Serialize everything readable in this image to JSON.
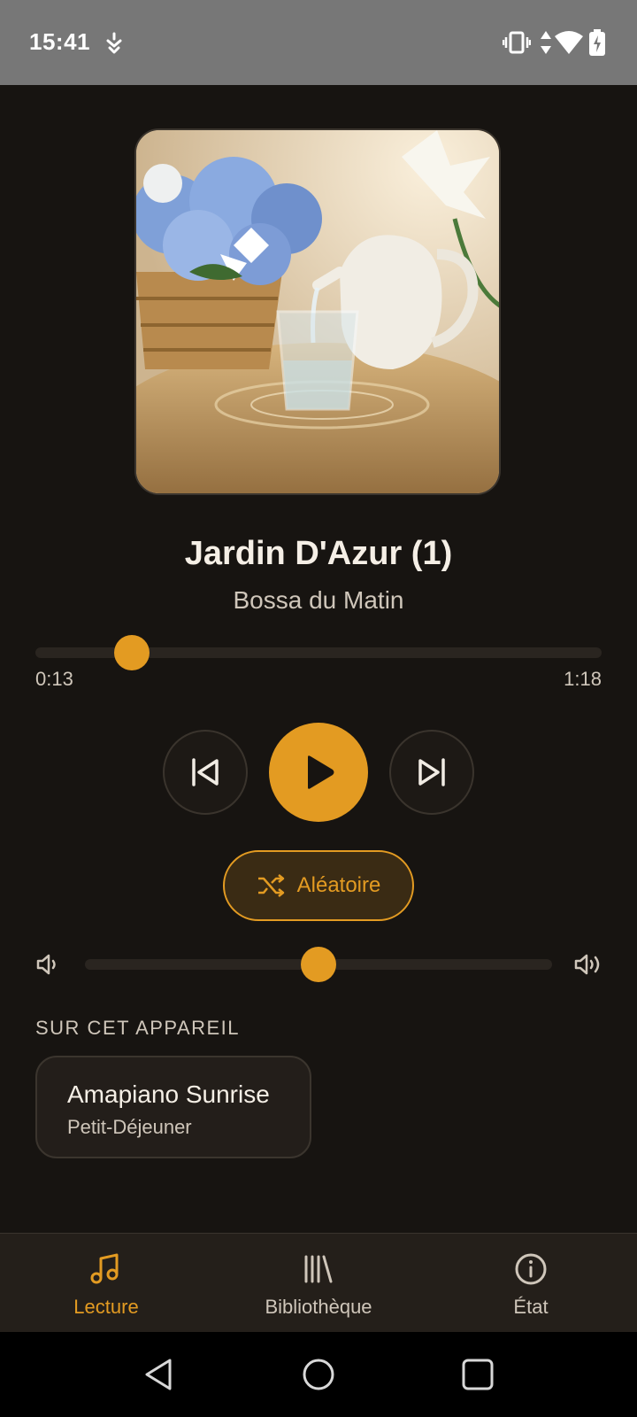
{
  "status_bar": {
    "time": "15:41",
    "icons": [
      "notification-icon",
      "vibrate-icon",
      "data-arrows-icon",
      "wifi-icon",
      "battery-charging-icon"
    ]
  },
  "track": {
    "title": "Jardin D'Azur (1)",
    "artist": "Bossa du Matin",
    "elapsed": "0:13",
    "duration": "1:18",
    "progress_fraction": 0.17
  },
  "controls": {
    "previous_icon": "skip-previous-icon",
    "play_icon": "play-icon",
    "next_icon": "skip-next-icon",
    "shuffle_label": "Aléatoire",
    "shuffle_icon": "shuffle-icon"
  },
  "volume": {
    "level_fraction": 0.5,
    "low_icon": "volume-low-icon",
    "high_icon": "volume-high-icon"
  },
  "devices": {
    "heading": "SUR CET APPAREIL",
    "items": [
      {
        "title": "Amapiano Sunrise",
        "subtitle": "Petit-Déjeuner"
      }
    ]
  },
  "bottom_nav": {
    "items": [
      {
        "label": "Lecture",
        "icon": "music-note-icon",
        "active": true
      },
      {
        "label": "Bibliothèque",
        "icon": "library-icon",
        "active": false
      },
      {
        "label": "État",
        "icon": "info-icon",
        "active": false
      }
    ]
  },
  "colors": {
    "accent": "#e39b22",
    "background": "#171411",
    "surface": "#241f1a"
  }
}
